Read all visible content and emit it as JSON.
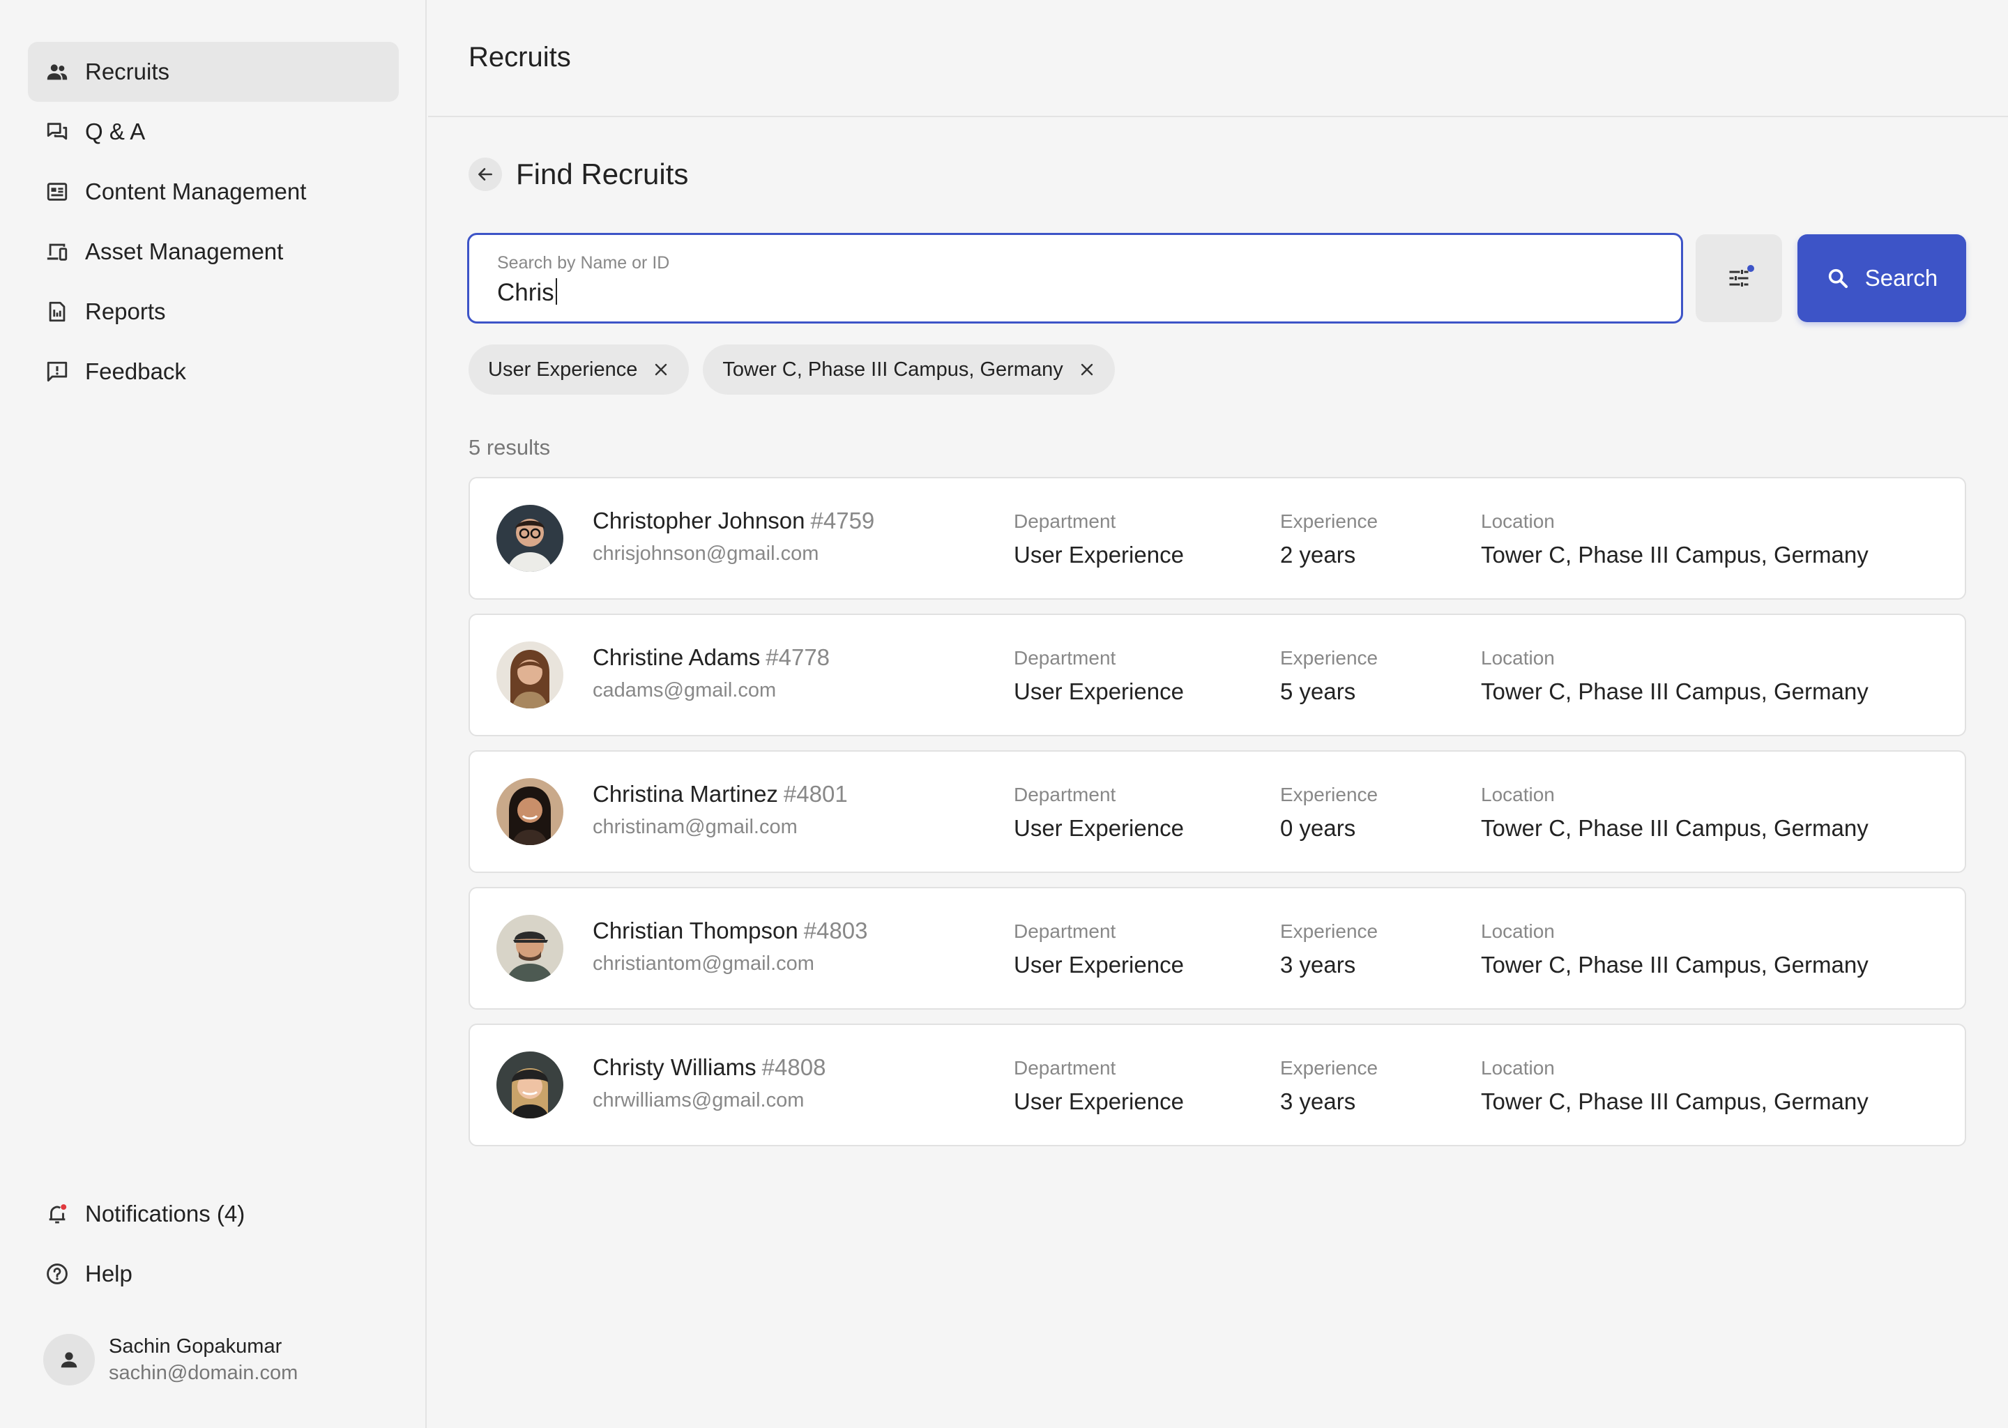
{
  "sidebar": {
    "nav": [
      {
        "label": "Recruits",
        "icon": "people-icon",
        "active": true
      },
      {
        "label": "Q & A",
        "icon": "forum-icon"
      },
      {
        "label": "Content Management",
        "icon": "article-icon"
      },
      {
        "label": "Asset Management",
        "icon": "devices-icon"
      },
      {
        "label": "Reports",
        "icon": "report-icon"
      },
      {
        "label": "Feedback",
        "icon": "feedback-icon"
      }
    ],
    "bottom": [
      {
        "label": "Notifications (4)",
        "icon": "bell-icon"
      },
      {
        "label": "Help",
        "icon": "help-icon"
      }
    ],
    "user": {
      "name": "Sachin Gopakumar",
      "email": "sachin@domain.com"
    }
  },
  "header": {
    "title": "Recruits"
  },
  "page": {
    "title": "Find Recruits"
  },
  "search": {
    "label": "Search by Name or ID",
    "value": "Chris",
    "button_label": "Search"
  },
  "filters": [
    {
      "label": "User Experience"
    },
    {
      "label": "Tower C, Phase III Campus, Germany"
    }
  ],
  "results": {
    "count_label": "5 results",
    "column_labels": {
      "department": "Department",
      "experience": "Experience",
      "location": "Location"
    },
    "items": [
      {
        "name": "Christopher Johnson",
        "id": "#4759",
        "email": "chrisjohnson@gmail.com",
        "department": "User Experience",
        "experience": "2 years",
        "location": "Tower C, Phase III Campus, Germany"
      },
      {
        "name": "Christine Adams",
        "id": "#4778",
        "email": "cadams@gmail.com",
        "department": "User Experience",
        "experience": "5 years",
        "location": "Tower C, Phase III Campus, Germany"
      },
      {
        "name": "Christina Martinez",
        "id": "#4801",
        "email": "christinam@gmail.com",
        "department": "User Experience",
        "experience": "0 years",
        "location": "Tower C, Phase III Campus, Germany"
      },
      {
        "name": "Christian Thompson",
        "id": "#4803",
        "email": "christiantom@gmail.com",
        "department": "User Experience",
        "experience": "3 years",
        "location": "Tower C, Phase III Campus, Germany"
      },
      {
        "name": "Christy Williams",
        "id": "#4808",
        "email": "chrwilliams@gmail.com",
        "department": "User Experience",
        "experience": "3 years",
        "location": "Tower C, Phase III Campus, Germany"
      }
    ]
  },
  "colors": {
    "accent": "#3d54c7",
    "notification_dot": "#e0393e"
  }
}
